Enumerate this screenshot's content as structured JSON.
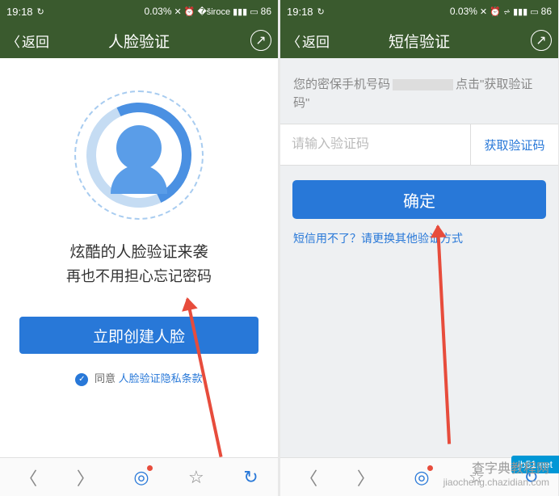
{
  "status": {
    "time": "19:18",
    "percent_text": "0.03%",
    "battery": "86"
  },
  "nav": {
    "back": "返回",
    "title_left": "人脸验证",
    "title_right": "短信验证"
  },
  "left_panel": {
    "headline": "炫酷的人脸验证来袭",
    "subhead": "再也不用担心忘记密码",
    "primary_btn": "立即创建人脸",
    "agree_prefix": "同意",
    "agree_link": "人脸验证隐私条款"
  },
  "right_panel": {
    "hint_prefix": "您的密保手机号码",
    "hint_suffix1": "点击\"获取验证码\"",
    "placeholder": "请输入验证码",
    "get_code": "获取验证码",
    "confirm": "确定",
    "alt_link": "短信用不了？请更换其他验证方式"
  },
  "watermark": {
    "line1": "查字典教程网",
    "line2": "jiaocheng.chazidian.com",
    "badge": "jb51.net"
  }
}
